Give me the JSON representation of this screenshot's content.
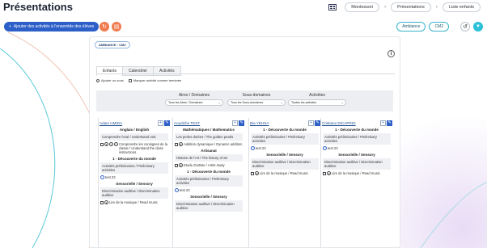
{
  "header": {
    "title": "Présentations"
  },
  "breadcrumbs": [
    "Montessori",
    "Présentations",
    "Liste enfants"
  ],
  "toolbar": {
    "add_label": "Ajouter des activités à l'ensemble des élèves"
  },
  "right_filters": {
    "ambiance": "Ambiance",
    "level": "CM2"
  },
  "panel": {
    "badge": "AMBIANCE : CM2",
    "tabs": [
      "Enfants",
      "Calendrier",
      "Activités"
    ],
    "options": {
      "add_sub": "Ajouter un sous",
      "mark_done": "Marquer activité comme terminée"
    },
    "filters": [
      {
        "label": "Aires / Domaines",
        "value": "Tous les Aires / Domaines"
      },
      {
        "label": "Sous-domaines",
        "value": "Tous les Sous-domaines"
      },
      {
        "label": "Activities",
        "value": "Toutes les activités"
      }
    ]
  },
  "columns": [
    {
      "name": "Adam HMIDA",
      "blocks": [
        {
          "domain": "Anglais / English",
          "box": "Comprendre l'oral / Understand oral",
          "acts": [
            {
              "kind": "multi",
              "text": "Comprendre les consignes de la classe / Understand the class instructions"
            }
          ]
        },
        {
          "domain": "1 - Découverte du monde",
          "box": "Activités préliminaires / Preliminary activities",
          "acts": [
            {
              "kind": "o",
              "text": "test 23"
            }
          ]
        },
        {
          "domain": "Sensorielle / Sensory",
          "box": "Discrimination auditive / Discrimination auditive",
          "acts": [
            {
              "kind": "single",
              "text": "Lire de la musique / Read music"
            }
          ]
        }
      ]
    },
    {
      "name": "Aoudiche TEST",
      "blocks": [
        {
          "domain": "Mathématiques / Mathematics",
          "box": "Les perles dorées / The golden pearls",
          "acts": [
            {
              "kind": "single",
              "text": "Addition dynamique / Dynamic addition"
            }
          ]
        },
        {
          "domain": "Artisanat",
          "box": "Histoire de l'Art / The history of art",
          "acts": [
            {
              "kind": "single",
              "text": "Etude d'artiste / Artist study"
            }
          ]
        },
        {
          "domain": "1 - Découverte du monde",
          "box": "Activités préliminaires / Preliminary activities",
          "acts": [
            {
              "kind": "o",
              "text": "test 23"
            }
          ]
        },
        {
          "domain": "Sensorielle / Sensory",
          "box": "Discrimination auditive / Discrimination auditive",
          "acts": []
        }
      ]
    },
    {
      "name": "Bia YEHSA",
      "blocks": [
        {
          "domain": "1 - Découverte du monde",
          "box": "Activités préliminaires / Preliminary activities",
          "acts": [
            {
              "kind": "o",
              "text": "test 23"
            }
          ]
        },
        {
          "domain": "Sensorielle / Sensory",
          "box": "Discrimination auditive / Discrimination auditive",
          "acts": [
            {
              "kind": "single",
              "text": "Lire de la musique / Read music"
            }
          ]
        }
      ]
    },
    {
      "name": "Cristiano DICAPRIO",
      "blocks": [
        {
          "domain": "1 - Découverte du monde",
          "box": "Activités préliminaires / Preliminary activities",
          "acts": [
            {
              "kind": "o",
              "text": "test 23"
            }
          ]
        },
        {
          "domain": "Sensorielle / Sensory",
          "box": "Discrimination auditive / Discrimination auditive",
          "acts": [
            {
              "kind": "single",
              "text": "Lire de la musique / Read music"
            }
          ]
        }
      ]
    }
  ]
}
